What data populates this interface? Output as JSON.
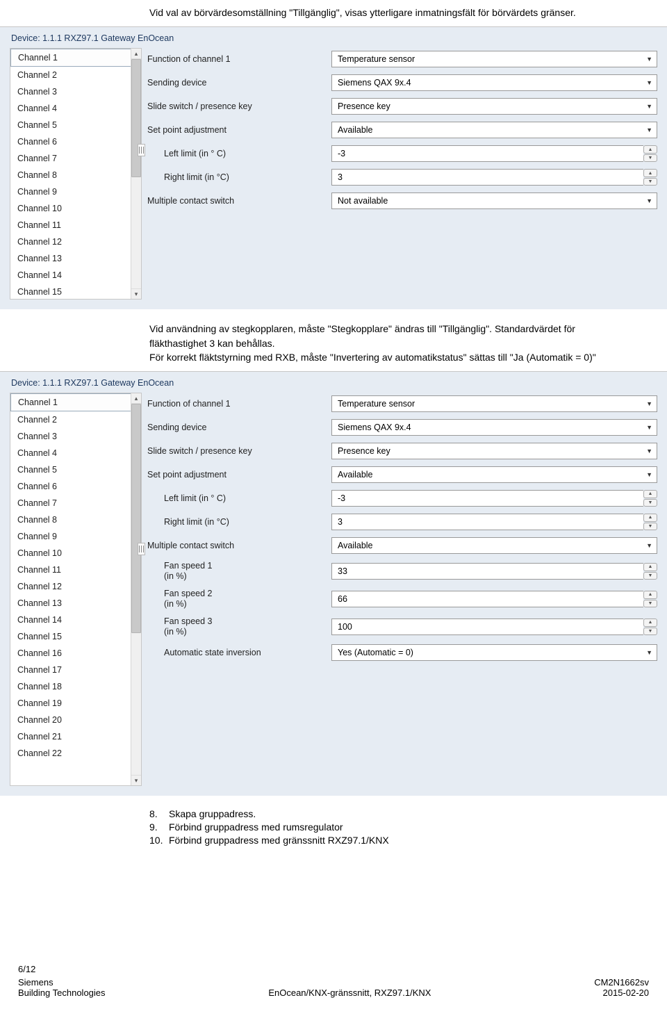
{
  "top_text": "Vid val av börvärdesomställning \"Tillgänglig\", visas ytterligare inmatningsfält för börvärdets gränser.",
  "device_line": "Device: 1.1.1  RXZ97.1 Gateway EnOcean",
  "channels_short": [
    "Channel 1",
    "Channel 2",
    "Channel 3",
    "Channel 4",
    "Channel 5",
    "Channel 6",
    "Channel 7",
    "Channel 8",
    "Channel 9",
    "Channel 10",
    "Channel 11",
    "Channel 12",
    "Channel 13",
    "Channel 14",
    "Channel 15"
  ],
  "channels_tall": [
    "Channel 1",
    "Channel 2",
    "Channel 3",
    "Channel 4",
    "Channel 5",
    "Channel 6",
    "Channel 7",
    "Channel 8",
    "Channel 9",
    "Channel 10",
    "Channel 11",
    "Channel 12",
    "Channel 13",
    "Channel 14",
    "Channel 15",
    "Channel 16",
    "Channel 17",
    "Channel 18",
    "Channel 19",
    "Channel 20",
    "Channel 21",
    "Channel 22"
  ],
  "panel1": {
    "rows": {
      "func_label": "Function of channel 1",
      "func_value": "Temperature sensor",
      "send_label": "Sending device",
      "send_value": "Siemens QAX 9x.4",
      "slide_label": "Slide switch / presence key",
      "slide_value": "Presence key",
      "setp_label": "Set point adjustment",
      "setp_value": "Available",
      "left_label": "Left limit   (in ° C)",
      "left_value": "-3",
      "right_label": "Right limit   (in °C)",
      "right_value": "3",
      "multi_label": "Multiple contact switch",
      "multi_value": "Not available"
    }
  },
  "mid_text_1": "Vid användning av stegkopplaren, måste \"Stegkopplare\" ändras till \"Tillgänglig\". Standardvärdet för fläkthastighet 3 kan behållas.",
  "mid_text_2": "För korrekt fläktstyrning med RXB, måste \"Invertering av automatikstatus\" sättas till \"Ja (Automatik = 0)\"",
  "panel2": {
    "rows": {
      "func_label": "Function of channel 1",
      "func_value": "Temperature sensor",
      "send_label": "Sending device",
      "send_value": "Siemens QAX 9x.4",
      "slide_label": "Slide switch / presence key",
      "slide_value": "Presence key",
      "setp_label": "Set point adjustment",
      "setp_value": "Available",
      "left_label": "Left limit   (in ° C)",
      "left_value": "-3",
      "right_label": "Right limit   (in °C)",
      "right_value": "3",
      "multi_label": "Multiple contact switch",
      "multi_value": "Available",
      "fs1_label": "Fan speed 1\n(in %)",
      "fs1_value": "33",
      "fs2_label": "Fan speed 2\n(in %)",
      "fs2_value": "66",
      "fs3_label": "Fan speed 3\n(in %)",
      "fs3_value": "100",
      "asi_label": "Automatic state inversion",
      "asi_value": "Yes (Automatic = 0)"
    }
  },
  "list": {
    "l8": "Skapa gruppadress.",
    "l9": "Förbind gruppadress med rumsregulator",
    "l10": "Förbind gruppadress med gränssnitt RXZ97.1/KNX"
  },
  "footer": {
    "page": "6/12",
    "left1": "Siemens",
    "left2": "Building Technologies",
    "center": "EnOcean/KNX-gränssnitt, RXZ97.1/KNX",
    "right1": "CM2N1662sv",
    "right2": "2015-02-20"
  }
}
